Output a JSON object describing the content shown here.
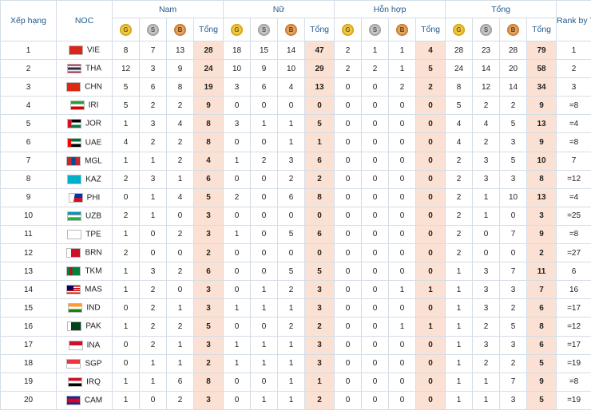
{
  "header": {
    "rank": "Xếp hạng",
    "noc": "NOC",
    "groups": [
      "Nam",
      "Nữ",
      "Hỗn hợp",
      "Tổng"
    ],
    "total_label": "Tổng",
    "rank_by_total": "Rank by Total",
    "medal_glyphs": {
      "gold": "G",
      "silver": "S",
      "bronze": "B"
    }
  },
  "colors": {
    "gold": "#f0c84a",
    "silver": "#c4c4c4",
    "bronze": "#e5a45f",
    "total_bg": "#fbe1d3",
    "header_text": "#1f5a8e"
  },
  "rows": [
    {
      "rank": "1",
      "noc": "VIE",
      "flag": "flag-vietnam",
      "vals": [
        "8",
        "7",
        "13",
        "28",
        "18",
        "15",
        "14",
        "47",
        "2",
        "1",
        "1",
        "4",
        "28",
        "23",
        "28",
        "79"
      ],
      "rbt": "1"
    },
    {
      "rank": "2",
      "noc": "THA",
      "flag": "flag-thailand",
      "vals": [
        "12",
        "3",
        "9",
        "24",
        "10",
        "9",
        "10",
        "29",
        "2",
        "2",
        "1",
        "5",
        "24",
        "14",
        "20",
        "58"
      ],
      "rbt": "2"
    },
    {
      "rank": "3",
      "noc": "CHN",
      "flag": "flag-china",
      "vals": [
        "5",
        "6",
        "8",
        "19",
        "3",
        "6",
        "4",
        "13",
        "0",
        "0",
        "2",
        "2",
        "8",
        "12",
        "14",
        "34"
      ],
      "rbt": "3"
    },
    {
      "rank": "4",
      "noc": "IRI",
      "flag": "flag-iran",
      "vals": [
        "5",
        "2",
        "2",
        "9",
        "0",
        "0",
        "0",
        "0",
        "0",
        "0",
        "0",
        "0",
        "5",
        "2",
        "2",
        "9"
      ],
      "rbt": "=8"
    },
    {
      "rank": "5",
      "noc": "JOR",
      "flag": "flag-jordan",
      "vals": [
        "1",
        "3",
        "4",
        "8",
        "3",
        "1",
        "1",
        "5",
        "0",
        "0",
        "0",
        "0",
        "4",
        "4",
        "5",
        "13"
      ],
      "rbt": "=4"
    },
    {
      "rank": "6",
      "noc": "UAE",
      "flag": "flag-uae",
      "vals": [
        "4",
        "2",
        "2",
        "8",
        "0",
        "0",
        "1",
        "1",
        "0",
        "0",
        "0",
        "0",
        "4",
        "2",
        "3",
        "9"
      ],
      "rbt": "=8"
    },
    {
      "rank": "7",
      "noc": "MGL",
      "flag": "flag-mongolia",
      "vals": [
        "1",
        "1",
        "2",
        "4",
        "1",
        "2",
        "3",
        "6",
        "0",
        "0",
        "0",
        "0",
        "2",
        "3",
        "5",
        "10"
      ],
      "rbt": "7"
    },
    {
      "rank": "8",
      "noc": "KAZ",
      "flag": "flag-kazakhstan",
      "vals": [
        "2",
        "3",
        "1",
        "6",
        "0",
        "0",
        "2",
        "2",
        "0",
        "0",
        "0",
        "0",
        "2",
        "3",
        "3",
        "8"
      ],
      "rbt": "=12"
    },
    {
      "rank": "9",
      "noc": "PHI",
      "flag": "flag-philippines",
      "vals": [
        "0",
        "1",
        "4",
        "5",
        "2",
        "0",
        "6",
        "8",
        "0",
        "0",
        "0",
        "0",
        "2",
        "1",
        "10",
        "13"
      ],
      "rbt": "=4"
    },
    {
      "rank": "10",
      "noc": "UZB",
      "flag": "flag-uzbekistan",
      "vals": [
        "2",
        "1",
        "0",
        "3",
        "0",
        "0",
        "0",
        "0",
        "0",
        "0",
        "0",
        "0",
        "2",
        "1",
        "0",
        "3"
      ],
      "rbt": "=25"
    },
    {
      "rank": "11",
      "noc": "TPE",
      "flag": "flag-chinese-taipei",
      "vals": [
        "1",
        "0",
        "2",
        "3",
        "1",
        "0",
        "5",
        "6",
        "0",
        "0",
        "0",
        "0",
        "2",
        "0",
        "7",
        "9"
      ],
      "rbt": "=8"
    },
    {
      "rank": "12",
      "noc": "BRN",
      "flag": "flag-bahrain",
      "vals": [
        "2",
        "0",
        "0",
        "2",
        "0",
        "0",
        "0",
        "0",
        "0",
        "0",
        "0",
        "0",
        "2",
        "0",
        "0",
        "2"
      ],
      "rbt": "=27"
    },
    {
      "rank": "13",
      "noc": "TKM",
      "flag": "flag-turkmenistan",
      "vals": [
        "1",
        "3",
        "2",
        "6",
        "0",
        "0",
        "5",
        "5",
        "0",
        "0",
        "0",
        "0",
        "1",
        "3",
        "7",
        "11"
      ],
      "rbt": "6"
    },
    {
      "rank": "14",
      "noc": "MAS",
      "flag": "flag-malaysia",
      "vals": [
        "1",
        "2",
        "0",
        "3",
        "0",
        "1",
        "2",
        "3",
        "0",
        "0",
        "1",
        "1",
        "1",
        "3",
        "3",
        "7"
      ],
      "rbt": "16"
    },
    {
      "rank": "15",
      "noc": "IND",
      "flag": "flag-india",
      "vals": [
        "0",
        "2",
        "1",
        "3",
        "1",
        "1",
        "1",
        "3",
        "0",
        "0",
        "0",
        "0",
        "1",
        "3",
        "2",
        "6"
      ],
      "rbt": "=17"
    },
    {
      "rank": "16",
      "noc": "PAK",
      "flag": "flag-pakistan",
      "vals": [
        "1",
        "2",
        "2",
        "5",
        "0",
        "0",
        "2",
        "2",
        "0",
        "0",
        "1",
        "1",
        "1",
        "2",
        "5",
        "8"
      ],
      "rbt": "=12"
    },
    {
      "rank": "17",
      "noc": "INA",
      "flag": "flag-indonesia",
      "vals": [
        "0",
        "2",
        "1",
        "3",
        "1",
        "1",
        "1",
        "3",
        "0",
        "0",
        "0",
        "0",
        "1",
        "3",
        "3",
        "6"
      ],
      "rbt": "=17"
    },
    {
      "rank": "18",
      "noc": "SGP",
      "flag": "flag-singapore",
      "vals": [
        "0",
        "1",
        "1",
        "2",
        "1",
        "1",
        "1",
        "3",
        "0",
        "0",
        "0",
        "0",
        "1",
        "2",
        "2",
        "5"
      ],
      "rbt": "=19"
    },
    {
      "rank": "19",
      "noc": "IRQ",
      "flag": "flag-iraq",
      "vals": [
        "1",
        "1",
        "6",
        "8",
        "0",
        "0",
        "1",
        "1",
        "0",
        "0",
        "0",
        "0",
        "1",
        "1",
        "7",
        "9"
      ],
      "rbt": "=8"
    },
    {
      "rank": "20",
      "noc": "CAM",
      "flag": "flag-cambodia",
      "vals": [
        "1",
        "0",
        "2",
        "3",
        "0",
        "1",
        "1",
        "2",
        "0",
        "0",
        "0",
        "0",
        "1",
        "1",
        "3",
        "5"
      ],
      "rbt": "=19"
    }
  ]
}
